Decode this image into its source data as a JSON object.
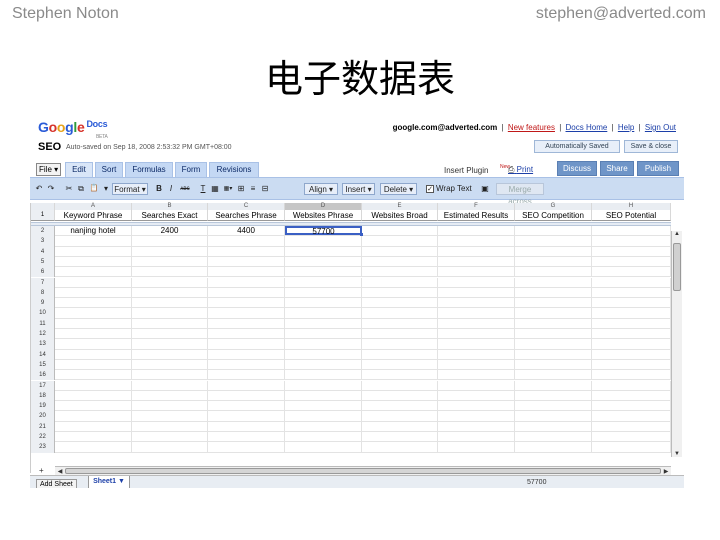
{
  "slide": {
    "author": "Stephen Noton",
    "email": "stephen@adverted.com",
    "title": "电子数据表"
  },
  "app": {
    "logo": {
      "letters": [
        "G",
        "o",
        "o",
        "g",
        "l",
        "e"
      ],
      "product": "Docs",
      "beta": "BETA"
    },
    "doc_title": "SEO",
    "autosave_text": "Auto-saved on Sep 18, 2008 2:53:32 PM GMT+08:00",
    "top_links": {
      "account": "google.com@adverted.com",
      "separator": "|",
      "new_features": "New features",
      "docs_home": "Docs Home",
      "help": "Help",
      "sign_out": "Sign Out"
    },
    "actions": {
      "autosave_button": "Automatically Saved",
      "save_close_button": "Save & close"
    },
    "menu": {
      "file": "File ▾",
      "tabs": [
        "Edit",
        "Sort",
        "Formulas",
        "Form",
        "Revisions"
      ],
      "insert_plugin": "Insert Plugin",
      "new_tag": "New",
      "print": "Print",
      "discuss": "Discuss",
      "share": "Share",
      "publish": "Publish"
    },
    "toolbar": {
      "undo": "↶",
      "redo": "↷",
      "cut": "✂",
      "copy": "⧉",
      "paste": "📋",
      "format": "Format ▾",
      "bold": "B",
      "italic": "I",
      "strike": "ᴀʙᴄ",
      "text_color": "T",
      "bg_color": "▦",
      "borders": "▦▾",
      "align": "Align ▾",
      "insert": "Insert ▾",
      "delete": "Delete ▾",
      "wrap_text": "Wrap Text",
      "wrap_checked": true,
      "merge_across": "Merge across"
    },
    "grid": {
      "column_letters": [
        "A",
        "B",
        "C",
        "D",
        "E",
        "F",
        "G",
        "H"
      ],
      "selected_column": "D",
      "header_row_number": "1",
      "headers": [
        "Keyword Phrase",
        "Searches Exact",
        "Searches Phrase",
        "Websites Phrase",
        "Websites Broad",
        "Estimated Results",
        "SEO Competition",
        "SEO Potential"
      ],
      "row_numbers": [
        "2",
        "3",
        "4",
        "5",
        "6",
        "7",
        "8",
        "9",
        "10",
        "11",
        "12",
        "13",
        "14",
        "15",
        "16",
        "17",
        "18",
        "19",
        "20",
        "21",
        "22",
        "23"
      ],
      "data_row": [
        "nanjing hotel",
        "2400",
        "4400",
        "57700",
        "",
        "",
        "",
        ""
      ],
      "add_row": "+"
    },
    "footer": {
      "add_sheet": "Add Sheet",
      "sheet_tab": "Sheet1 ▼",
      "selected_value": "57700"
    }
  }
}
